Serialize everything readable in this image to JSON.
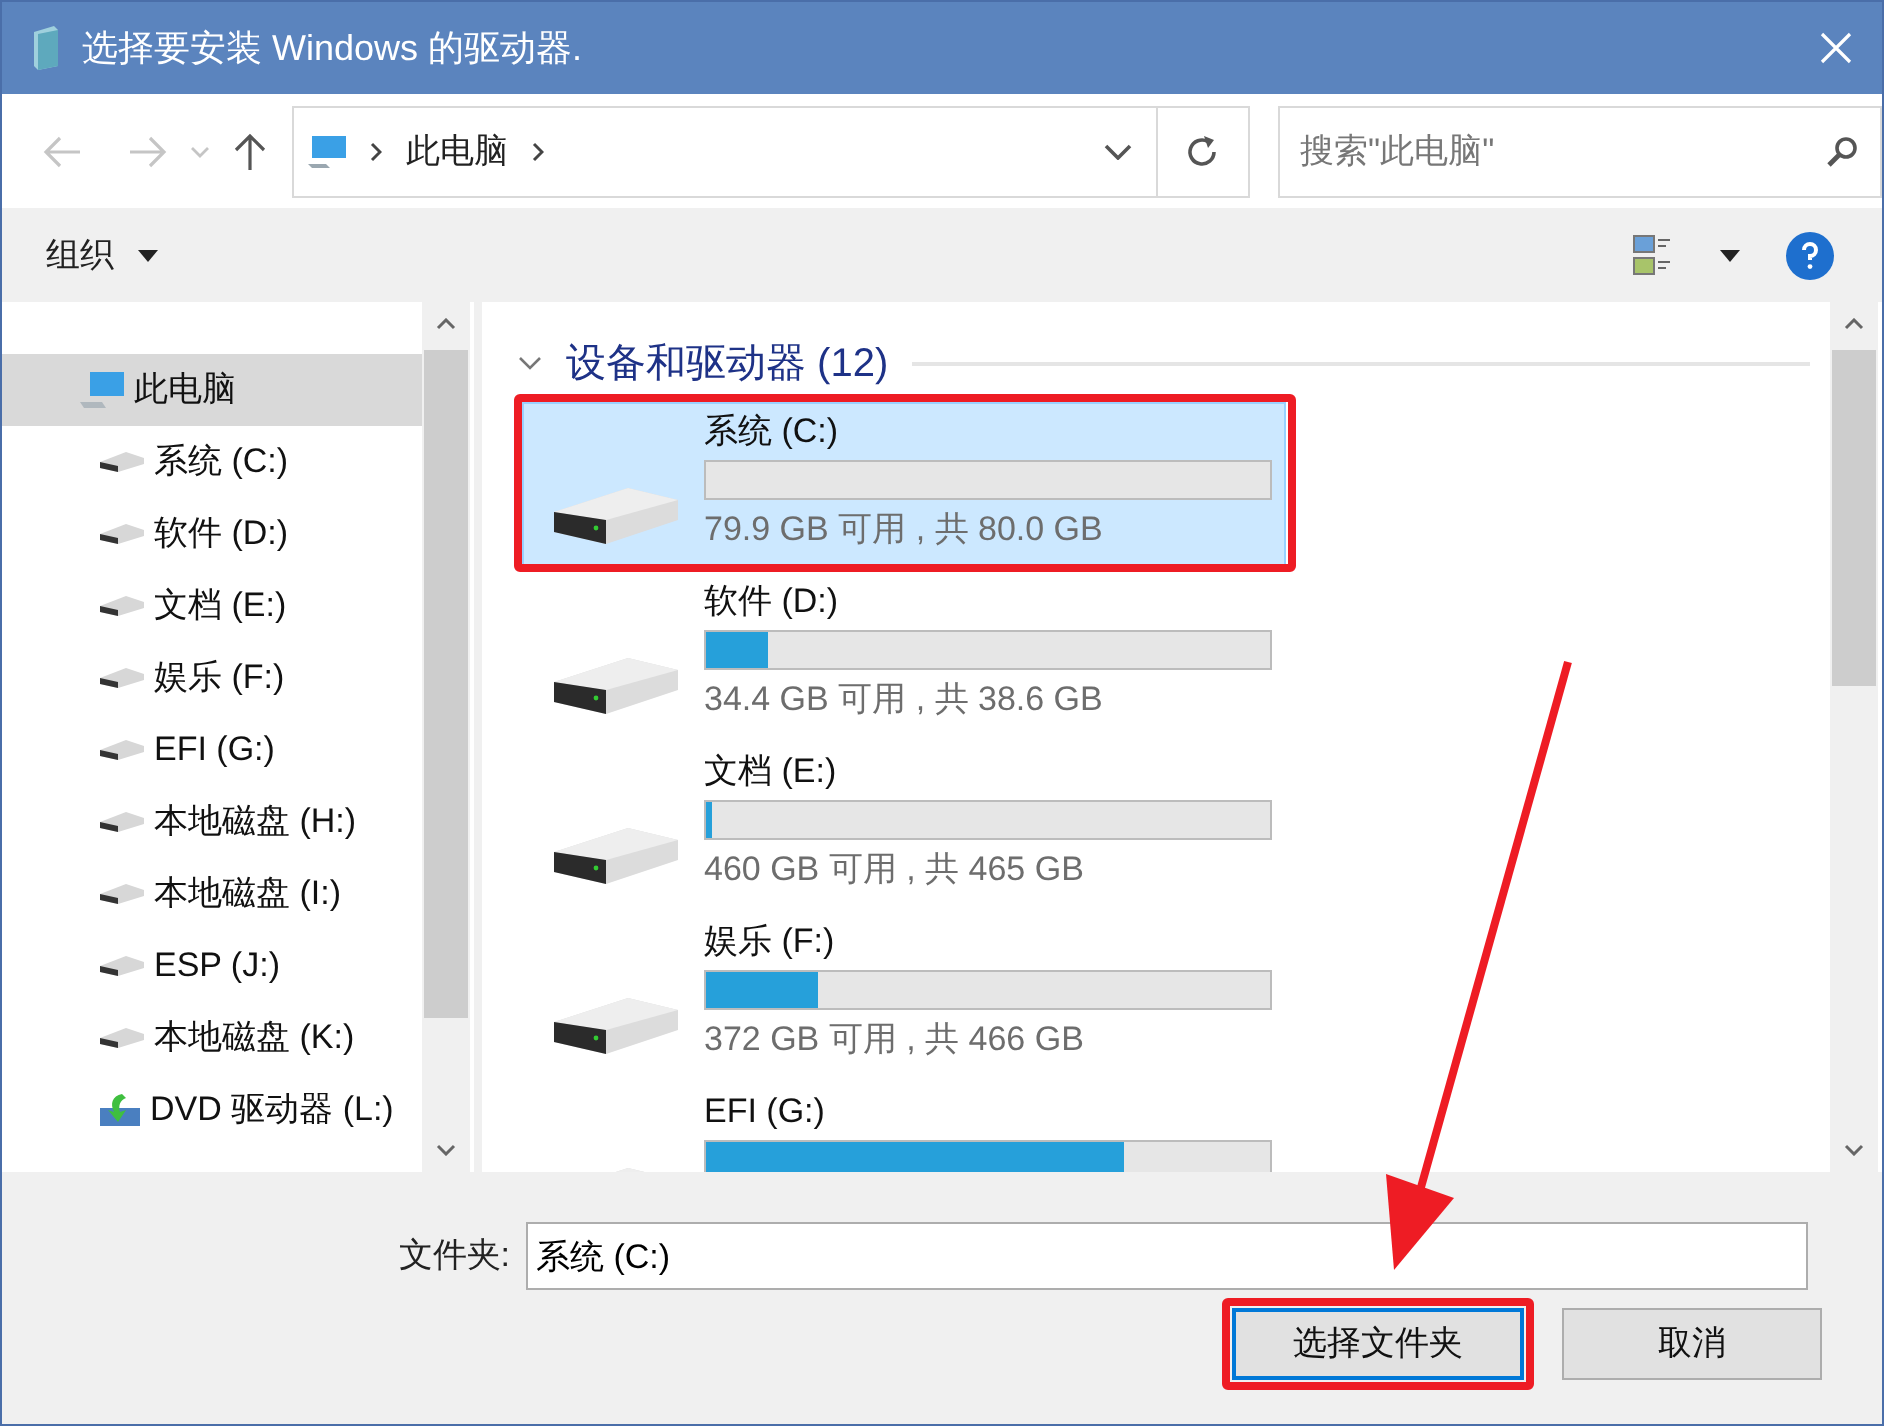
{
  "window": {
    "title": "选择要安装 Windows 的驱动器."
  },
  "address_bar": {
    "path": [
      "此电脑"
    ]
  },
  "search": {
    "placeholder": "搜索\"此电脑\""
  },
  "toolbar": {
    "organize": "组织"
  },
  "tree": [
    {
      "label": "此电脑",
      "kind": "computer",
      "selected": true,
      "children": [
        {
          "label": "系统 (C:)",
          "kind": "drive",
          "selected": false
        },
        {
          "label": "软件 (D:)",
          "kind": "drive",
          "selected": false
        },
        {
          "label": "文档 (E:)",
          "kind": "drive",
          "selected": false
        },
        {
          "label": "娱乐 (F:)",
          "kind": "drive",
          "selected": false
        },
        {
          "label": "EFI (G:)",
          "kind": "drive",
          "selected": false
        },
        {
          "label": "本地磁盘 (H:)",
          "kind": "drive",
          "selected": false
        },
        {
          "label": "本地磁盘 (I:)",
          "kind": "drive",
          "selected": false
        },
        {
          "label": "ESP (J:)",
          "kind": "drive",
          "selected": false
        },
        {
          "label": "本地磁盘 (K:)",
          "kind": "drive",
          "selected": false
        },
        {
          "label": "DVD 驱动器 (L:)",
          "kind": "dvd",
          "selected": false
        }
      ]
    }
  ],
  "group": {
    "title": "设备和驱动器 (12)",
    "expanded": true
  },
  "drives": [
    {
      "name": "系统 (C:)",
      "level": 0.0,
      "free": "79.9 GB 可用 , 共 80.0 GB",
      "selected": true,
      "highlighted": true
    },
    {
      "name": "软件 (D:)",
      "level": 0.11,
      "free": "34.4 GB 可用 , 共 38.6 GB",
      "selected": false,
      "highlighted": false
    },
    {
      "name": "文档 (E:)",
      "level": 0.011,
      "free": "460 GB 可用 , 共 465 GB",
      "selected": false,
      "highlighted": false
    },
    {
      "name": "娱乐 (F:)",
      "level": 0.2,
      "free": "372 GB 可用 , 共 466 GB",
      "selected": false,
      "highlighted": false
    },
    {
      "name": "EFI (G:)",
      "level": 0.74,
      "selected": false,
      "highlighted": false
    }
  ],
  "folder_field": {
    "label": "文件夹:",
    "value": "系统 (C:)"
  },
  "buttons": [
    {
      "label": "选择文件夹",
      "default": true,
      "highlighted": true
    },
    {
      "label": "取消",
      "default": false,
      "highlighted": false
    }
  ]
}
